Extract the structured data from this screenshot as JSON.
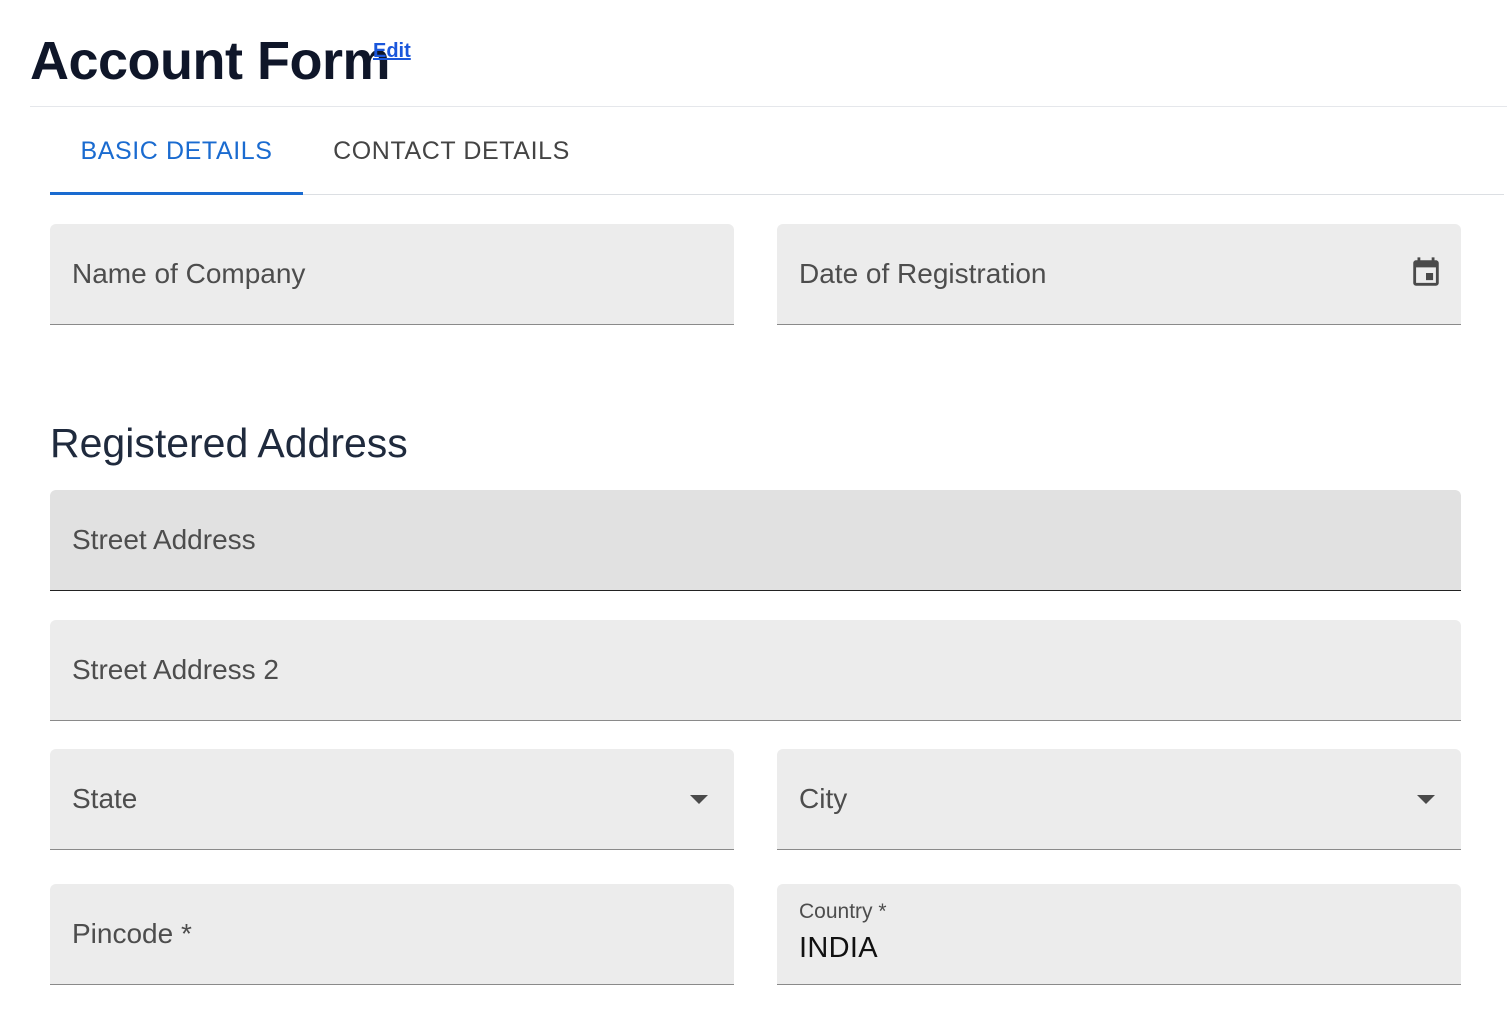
{
  "header": {
    "title": "Account Form",
    "edit_label": "Edit"
  },
  "tabs": [
    {
      "label": "BASIC DETAILS",
      "active": true
    },
    {
      "label": "CONTACT DETAILS",
      "active": false
    }
  ],
  "fields": {
    "company_name": {
      "label": "Name of Company"
    },
    "registration_date": {
      "label": "Date of Registration",
      "icon": "calendar-icon"
    },
    "street_address": {
      "label": "Street Address"
    },
    "street_address_2": {
      "label": "Street Address 2"
    },
    "state": {
      "label": "State",
      "icon": "chevron-down-icon"
    },
    "city": {
      "label": "City",
      "icon": "chevron-down-icon"
    },
    "pincode": {
      "label": "Pincode *"
    },
    "country": {
      "label": "Country *",
      "value": "INDIA"
    }
  },
  "sections": {
    "registered_address": "Registered Address"
  },
  "colors": {
    "accent": "#1a6bd0",
    "link": "#1a56db",
    "field_bg": "#ececec",
    "field_hover_bg": "#e1e1e1"
  }
}
